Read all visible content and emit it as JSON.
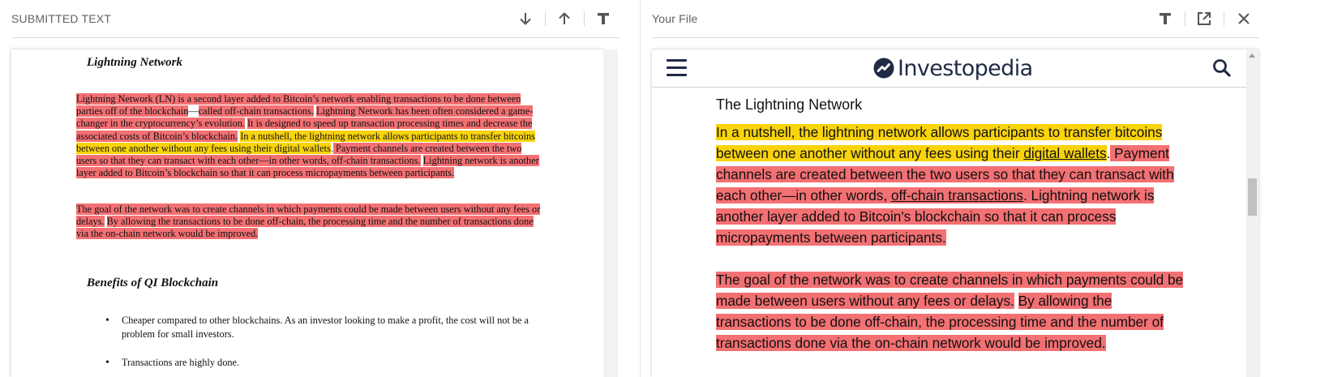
{
  "left_pane": {
    "title": "SUBMITTED TEXT",
    "buttons": [
      "next-match",
      "previous-match",
      "text-mode"
    ]
  },
  "right_pane": {
    "title": "Your File",
    "buttons": [
      "text-mode",
      "open-external",
      "close"
    ]
  },
  "submitted_doc": {
    "heading1": "Lightning Network",
    "para1": [
      {
        "text": "Lightning Network (LN) is a second layer added to Bitcoin’s network enabling transactions to be done between parties off of the blockchain",
        "hl": "red"
      },
      {
        "text": "—",
        "hl": "none"
      },
      {
        "text": "called off-chain transactions.",
        "hl": "red"
      },
      {
        "text": " ",
        "hl": "none"
      },
      {
        "text": "Lightning Network has been often considered a game-changer in the cryptocurrency’s evolution.",
        "hl": "red"
      },
      {
        "text": " ",
        "hl": "none"
      },
      {
        "text": "It is designed to speed up transaction processing times and decrease the associated costs of Bitcoin’s blockchain.",
        "hl": "red"
      },
      {
        "text": "  ",
        "hl": "none"
      },
      {
        "text": "In a nutshell, the lightning network allows participants to transfer bitcoins between one another without any fees using their digital wallets",
        "hl": "yellow"
      },
      {
        "text": ".",
        "hl": "none"
      },
      {
        "text": " Payment channels are created between the two users so that they can transact with each other—in other words, off-chain transactions.",
        "hl": "red"
      },
      {
        "text": " ",
        "hl": "none"
      },
      {
        "text": "Lightning network is another layer added to Bitcoin’s blockchain so that it can process micropayments between participants.",
        "hl": "red"
      }
    ],
    "para2": [
      {
        "text": "The goal of the network was to create channels in which payments could be made between users without any fees or delays.",
        "hl": "red"
      },
      {
        "text": " ",
        "hl": "none"
      },
      {
        "text": "By allowing the transactions to be done off-chain, the processing time and the number of transactions done via the on-chain network would be improved.",
        "hl": "red"
      }
    ],
    "heading2": "Benefits of QI Blockchain",
    "bullets": [
      "Cheaper compared to other blockchains. As an investor looking to make a profit, the cost will not be a problem for small investors.",
      "Transactions are highly done."
    ]
  },
  "source_site": {
    "name": "Investopedia",
    "heading": "The Lightning Network",
    "para1": [
      {
        "text": "In a nutshell, the lightning network allows participants to transfer bitcoins between one another without any fees using their ",
        "hl": "yellow",
        "link": false
      },
      {
        "text": "digital wallets",
        "hl": "yellow",
        "link": true
      },
      {
        "text": ".",
        "hl": "none",
        "link": false
      },
      {
        "text": " Payment channels are created between the two users so that they can transact with each other—in other words, ",
        "hl": "red",
        "link": false
      },
      {
        "text": "off-chain transactions",
        "hl": "red",
        "link": true
      },
      {
        "text": ".",
        "hl": "red",
        "link": false
      },
      {
        "text": " Lightning network is another layer added to Bitcoin's blockchain so that it can process micropayments between participants.",
        "hl": "red",
        "link": false
      }
    ],
    "para2": [
      {
        "text": "The goal of the network was to create channels in which payments could be made between users without any fees or delays.",
        "hl": "red",
        "link": false
      },
      {
        "text": " ",
        "hl": "none",
        "link": false
      },
      {
        "text": "By allowing the transactions to be done off-chain, the processing time and the number of transactions done via the on-chain network would be improved.",
        "hl": "red",
        "link": false
      }
    ]
  },
  "colors": {
    "match_red": "#f37073",
    "match_yellow": "#f9d30c",
    "icon_gray": "#555555",
    "brand_navy": "#1f2a44"
  }
}
